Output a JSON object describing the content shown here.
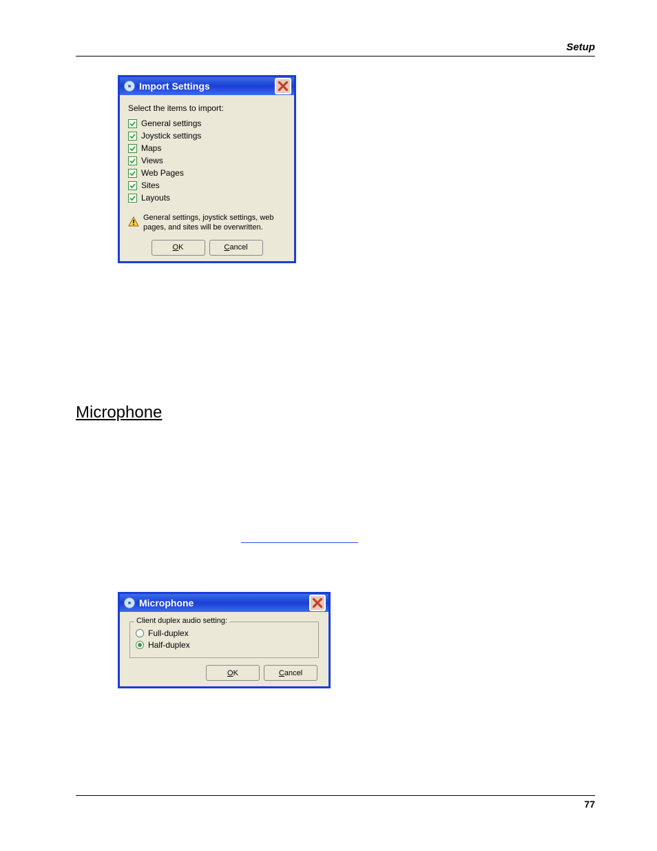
{
  "page": {
    "running_head": "Setup",
    "page_number": "77"
  },
  "import_dialog": {
    "title": "Import Settings",
    "prompt": "Select the items to import:",
    "items": [
      {
        "label": "General settings",
        "checked": true
      },
      {
        "label": "Joystick settings",
        "checked": true
      },
      {
        "label": "Maps",
        "checked": true
      },
      {
        "label": "Views",
        "checked": true
      },
      {
        "label": "Web Pages",
        "checked": true
      },
      {
        "label": "Sites",
        "checked": true
      },
      {
        "label": "Layouts",
        "checked": true
      }
    ],
    "warning": "General settings, joystick settings, web pages, and sites will be overwritten.",
    "ok_label": "OK",
    "ok_accel": "O",
    "cancel_label": "Cancel",
    "cancel_accel": "C"
  },
  "section": {
    "heading": "Microphone",
    "link_placeholder": ""
  },
  "mic_dialog": {
    "title": "Microphone",
    "group_label": "Client duplex audio setting:",
    "options": [
      {
        "label": "Full-duplex",
        "selected": false
      },
      {
        "label": "Half-duplex",
        "selected": true
      }
    ],
    "ok_label": "OK",
    "ok_accel": "O",
    "cancel_label": "Cancel",
    "cancel_accel": "C"
  }
}
